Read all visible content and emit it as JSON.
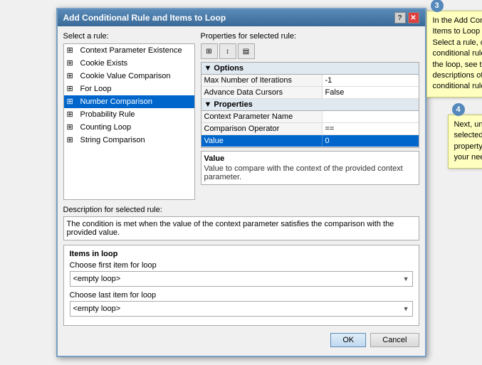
{
  "dialog": {
    "title": "Add Conditional Rule and Items to Loop",
    "title_buttons": [
      "?",
      "✕"
    ]
  },
  "left_panel": {
    "label": "Select a rule:",
    "rules": [
      {
        "label": "Context Parameter Existence",
        "selected": false
      },
      {
        "label": "Cookie Exists",
        "selected": false
      },
      {
        "label": "Cookie Value Comparison",
        "selected": false
      },
      {
        "label": "For Loop",
        "selected": false
      },
      {
        "label": "Number Comparison",
        "selected": true
      },
      {
        "label": "Probability Rule",
        "selected": false
      },
      {
        "label": "Counting Loop",
        "selected": false
      },
      {
        "label": "String Comparison",
        "selected": false
      }
    ]
  },
  "right_panel": {
    "label": "Properties for selected rule:",
    "options_section": "Options",
    "options": [
      {
        "name": "Max Number of Iterations",
        "value": "-1"
      },
      {
        "name": "Advance Data Cursors",
        "value": "False"
      }
    ],
    "properties_section": "Properties",
    "properties": [
      {
        "name": "Context Parameter Name",
        "value": "",
        "selected": false
      },
      {
        "name": "Comparison Operator",
        "value": "==",
        "selected": false
      },
      {
        "name": "Value",
        "value": "0",
        "selected": true
      }
    ]
  },
  "description_box": {
    "title": "Value",
    "text": "Value to compare with the context of the provided context parameter."
  },
  "selected_rule_desc": {
    "label": "Description for selected rule:",
    "text": "The condition is met when the value of the context parameter satisfies the comparison with the provided value."
  },
  "items_in_loop": {
    "label": "Items in loop",
    "first_item": {
      "label": "Choose first item for loop",
      "value": "<empty loop>"
    },
    "last_item": {
      "label": "Choose last item for loop",
      "value": "<empty loop>"
    }
  },
  "buttons": {
    "ok": "OK",
    "cancel": "Cancel"
  },
  "callout_3": {
    "number": "3",
    "text": "In the Add Conditional Rule and Items to Loop dialog box, under Select a rule, choose the type of conditional rule you want to use in the loop, see the table below for the descriptions of the different kinds of conditional rules that are available."
  },
  "callout_4": {
    "number": "4",
    "text": "Next, under Properties for selected rule, specify the property settings according to your needs."
  }
}
